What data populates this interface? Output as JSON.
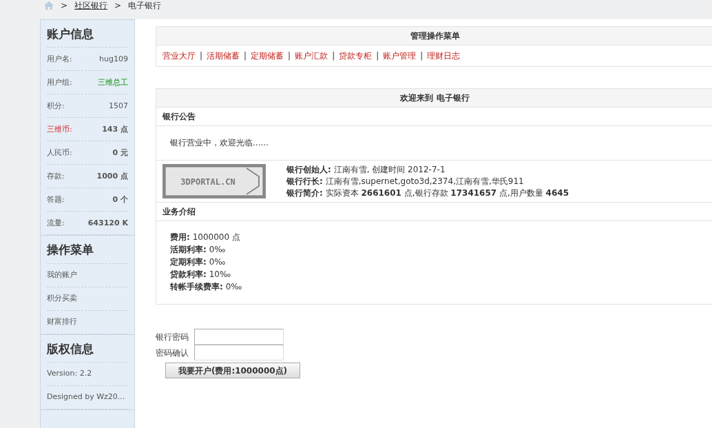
{
  "breadcrumb": [
    {
      "text": ">",
      "kind": "sep"
    },
    {
      "text": "社区银行",
      "kind": "link"
    },
    {
      "text": ">",
      "kind": "sep"
    },
    {
      "text": "电子银行",
      "kind": "current"
    }
  ],
  "sidebar": [
    {
      "title": "账户信息",
      "kind": "info",
      "items": [
        {
          "label": "用户名:",
          "value": "hug109",
          "bold": false,
          "kind": "plain"
        },
        {
          "label": "用户组:",
          "value": "三维总工",
          "bold": false,
          "kind": "group"
        },
        {
          "label": "积分:",
          "value": "1507",
          "bold": false,
          "kind": "plain"
        },
        {
          "label": "三维币:",
          "value": "143 点",
          "bold": true,
          "kind": "currency"
        },
        {
          "label": "人民币:",
          "value": "0 元",
          "bold": true,
          "kind": "plain"
        },
        {
          "label": "存款:",
          "value": "1000 点",
          "bold": true,
          "kind": "plain"
        },
        {
          "label": "答题:",
          "value": "0 个",
          "bold": true,
          "kind": "plain"
        },
        {
          "label": "流量:",
          "value": "643120 K",
          "bold": true,
          "kind": "plain"
        }
      ]
    },
    {
      "title": "操作菜单",
      "kind": "links",
      "items": [
        {
          "label": "我的账户"
        },
        {
          "label": "积分买卖"
        },
        {
          "label": "财富排行"
        }
      ]
    },
    {
      "title": "版权信息",
      "kind": "text",
      "items": [
        {
          "label": "Version: 2.2"
        },
        {
          "label": "Designed by Wz20..."
        }
      ]
    }
  ],
  "menu_panel": {
    "title": "管理操作菜单",
    "links": [
      "营业大厅",
      "活期储蓄",
      "定期储蓄",
      "账户汇款",
      "贷款专柜",
      "账户管理",
      "理财日志"
    ],
    "separator": "|"
  },
  "bank_panel": {
    "title": "欢迎来到 电子银行",
    "notice_heading": "银行公告",
    "notice": "银行营业中，欢迎光临......",
    "logo_text": "3DPORTAL.CN",
    "facts": [
      "**银行创始人:** 江南有雪, 创建时间 2012-7-1",
      "**银行行长:** 江南有雪,supernet,goto3d,2374,江南有雪,华氏911",
      "**银行简介:** 实际资本 **2661601** 点,银行存款 **17341657** 点,用户数量 **4645**"
    ],
    "intro_heading": "业务介绍",
    "intro": [
      "**费用:** 1000000 点",
      "**活期利率:** 0‰",
      "**定期利率:** 0‰",
      "**贷款利率:** 10‰",
      "**转帐手续费率:** 0‰"
    ]
  },
  "form": {
    "fields": [
      {
        "label": "银行密码"
      },
      {
        "label": "密码确认"
      }
    ],
    "submit": "我要开户(费用:1000000点)"
  }
}
